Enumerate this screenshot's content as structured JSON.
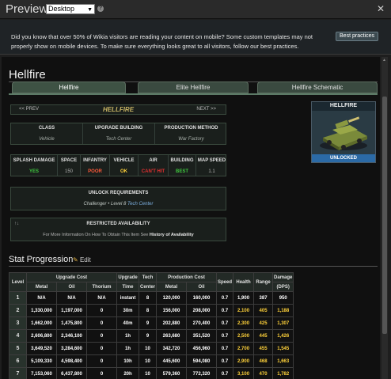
{
  "topbar": {
    "title": "Preview",
    "device": "Desktop"
  },
  "notice": {
    "text": "Did you know that over 50% of Wikia visitors are reading your content on mobile? Some custom templates may not properly show on mobile devices. To make sure everything looks great to all visitors, follow our best practices.",
    "button": "Best practices"
  },
  "page": {
    "title": "Hellfire",
    "tabs": [
      "Hellfire",
      "Elite Hellfire",
      "Hellfire Schematic"
    ]
  },
  "infobox": {
    "prev": "<< PREV",
    "next": "NEXT >>",
    "name": "HELLFIRE",
    "row1": [
      {
        "label": "CLASS",
        "value": "Vehicle"
      },
      {
        "label": "UPGRADE BUILDING",
        "value": "Tech Center"
      },
      {
        "label": "PRODUCTION METHOD",
        "value": "War Factory"
      }
    ],
    "row2": [
      {
        "label": "SPLASH DAMAGE",
        "value": "YES",
        "color": "#3ec63e"
      },
      {
        "label": "SPACE",
        "value": "150",
        "color": "#b0b0b0"
      },
      {
        "label": "INFANTRY",
        "value": "POOR",
        "color": "#ff5a3a"
      },
      {
        "label": "VEHICLE",
        "value": "OK",
        "color": "#ffd23a"
      },
      {
        "label": "AIR",
        "value": "CAN'T HIT",
        "color": "#e03030"
      },
      {
        "label": "BUILDING",
        "value": "BEST",
        "color": "#3ec63e"
      },
      {
        "label": "MAP SPEED",
        "value": "1.1",
        "color": "#b0b0b0"
      }
    ],
    "unlock_head": "UNLOCK REQUIREMENTS",
    "unlock_val_1": "Challenger",
    "unlock_sep": "•",
    "unlock_val_2": "Level 8",
    "unlock_val_3": "Tech Center",
    "restricted_icon": "↑↓",
    "restricted_head": "RESTRICTED AVAILABILITY",
    "restricted_text": "For More Information On How To Obtain This Item See",
    "restricted_link": "History of Availability",
    "image_name": "HELLFIRE",
    "image_status": "UNLOCKED"
  },
  "stats": {
    "heading": "Stat Progression",
    "edit": "Edit",
    "headers": {
      "level": "Level",
      "upgrade_cost": "Upgrade Cost",
      "upgrade": "Upgrade",
      "time": "Time",
      "tech": "Tech",
      "center": "Center",
      "production_cost": "Production Cost",
      "speed": "Speed",
      "health": "Health",
      "range": "Range",
      "damage": "Damage",
      "dps": "(DPS)",
      "metal": "Metal",
      "oil": "Oil",
      "thorium": "Thorium",
      "prod_metal": "Metal",
      "prod_oil": "Oil"
    },
    "rows": [
      [
        "1",
        "N/A",
        "N/A",
        "N/A",
        "instant",
        "8",
        "120,000",
        "160,000",
        "0.7",
        "1,900",
        "387",
        "950"
      ],
      [
        "2",
        "1,330,000",
        "1,197,000",
        "0",
        "30m",
        "8",
        "156,000",
        "208,000",
        "0.7",
        "2,100",
        "405",
        "1,188"
      ],
      [
        "3",
        "1,662,000",
        "1,475,800",
        "0",
        "40m",
        "9",
        "202,880",
        "270,400",
        "0.7",
        "2,300",
        "425",
        "1,307"
      ],
      [
        "4",
        "2,606,800",
        "2,346,100",
        "0",
        "1h",
        "9",
        "263,680",
        "351,520",
        "0.7",
        "2,500",
        "445",
        "1,426"
      ],
      [
        "5",
        "3,649,520",
        "3,284,600",
        "0",
        "1h",
        "10",
        "342,720",
        "456,960",
        "0.7",
        "2,700",
        "455",
        "1,545"
      ],
      [
        "6",
        "5,109,330",
        "4,598,400",
        "0",
        "10h",
        "10",
        "445,600",
        "594,080",
        "0.7",
        "2,900",
        "468",
        "1,663"
      ],
      [
        "7",
        "7,153,060",
        "6,437,800",
        "0",
        "20h",
        "10",
        "579,360",
        "772,320",
        "0.7",
        "3,100",
        "470",
        "1,782"
      ]
    ]
  }
}
